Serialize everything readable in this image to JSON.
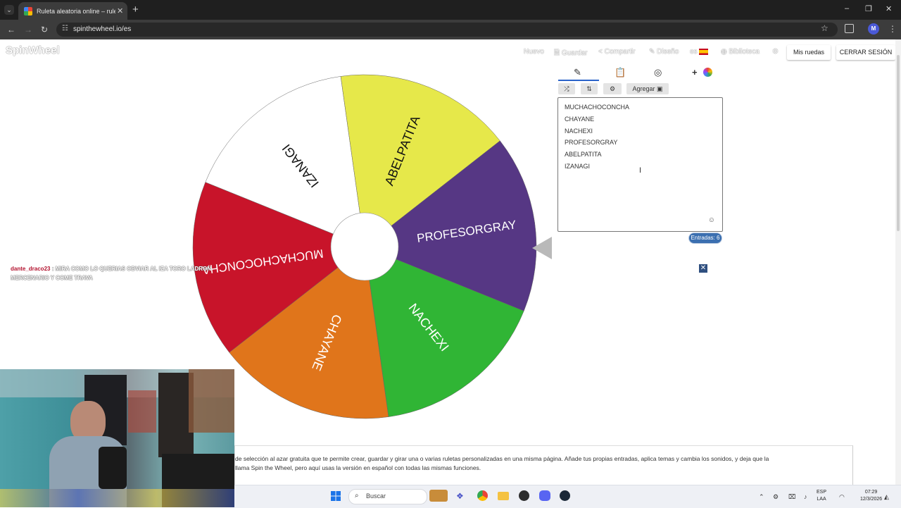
{
  "browser": {
    "tab_title": "Ruleta aleatoria online – ruleta",
    "tab_close": "✕",
    "new_tab": "+",
    "url": "spinthewheel.io/es",
    "minimize": "–",
    "restore": "❐",
    "close": "✕",
    "profile_initial": "M"
  },
  "header": {
    "logo": "SpinWheel",
    "menu": {
      "new": "Nuevo",
      "save": "Guardar",
      "share": "Compartir",
      "design": "Diseño",
      "lang": "es",
      "library": "Biblioteca"
    },
    "my_wheels": "Mis ruedas",
    "logout": "CERRAR SESIÓN"
  },
  "wheel": {
    "segments": [
      {
        "label": "PROFESORGRAY",
        "color": "#563784"
      },
      {
        "label": "NACHEXI",
        "color": "#30b535"
      },
      {
        "label": "CHAYANE",
        "color": "#e0751b"
      },
      {
        "label": "MUCHACHOCONCHA",
        "color": "#c8142a"
      },
      {
        "label": "IZANAGI",
        "color": "#ffffff"
      },
      {
        "label": "ABELPATITA",
        "color": "#e6e84a"
      }
    ]
  },
  "editor": {
    "add_label": "Agregar",
    "entries": [
      "MUCHACHOCONCHA",
      "CHAYANE",
      "NACHEXI",
      "PROFESORGRAY",
      "ABELPATITA",
      "IZANAGI"
    ],
    "count_label": "Entradas: 6"
  },
  "chat": {
    "user": "dante_draco23",
    "message": ": MIRA COMO LO QUERIAS OBVIAR AL IZA TORO LADRON MERCENARIO Y COME TRAVA"
  },
  "description": {
    "line1": "de selección al azar gratuita que te permite crear, guardar y girar una o varias ruletas personalizadas en una misma página. Añade tus propias entradas, aplica temas y cambia los sonidos, y deja que la",
    "line2": "llama Spin the Wheel, pero aquí usas la versión en español con todas las mismas funciones."
  },
  "taskbar": {
    "search": "Buscar",
    "lang_top": "ESP",
    "lang_bottom": "LAA",
    "time": "07:29",
    "date": "12/3/2026"
  }
}
